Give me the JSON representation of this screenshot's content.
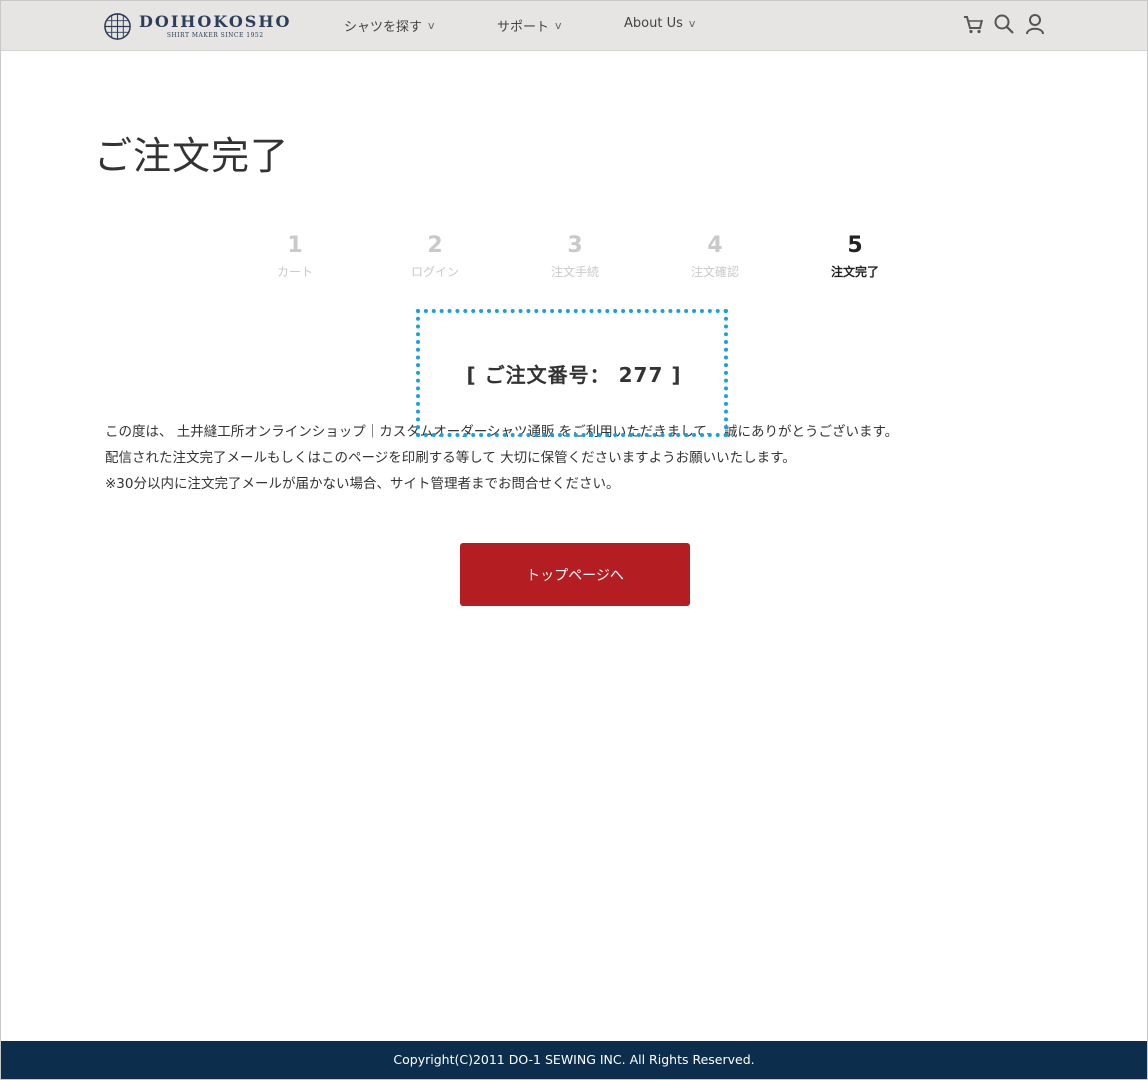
{
  "header": {
    "logo": {
      "name": "DOIHOKOSHO",
      "tagline": "SHIRT MAKER SINCE 1952"
    },
    "nav": [
      {
        "label": "シャツを探す",
        "chevron": "v"
      },
      {
        "label": "サポート",
        "chevron": "v"
      },
      {
        "label": "About Us",
        "chevron": "v"
      }
    ],
    "icons": [
      "cart-icon",
      "search-icon",
      "user-icon"
    ]
  },
  "page_title": "ご注文完了",
  "steps": [
    {
      "num": "1",
      "label": "カート",
      "active": false
    },
    {
      "num": "2",
      "label": "ログイン",
      "active": false
    },
    {
      "num": "3",
      "label": "注文手続",
      "active": false
    },
    {
      "num": "4",
      "label": "注文確認",
      "active": false
    },
    {
      "num": "5",
      "label": "注文完了",
      "active": true
    }
  ],
  "order": {
    "open": "[",
    "label": "ご注文番号：",
    "number": "277",
    "close": "]"
  },
  "message": {
    "line1": "この度は、 土井縫工所オンラインショップ｜カスタムオーダーシャツ通販 をご利用いただきまして、 誠にありがとうございます。",
    "line2": "配信された注文完了メールもしくはこのページを印刷する等して 大切に保管くださいますようお願いいたします。",
    "line3": "※30分以内に注文完了メールが届かない場合、サイト管理者までお問合せください。"
  },
  "button": {
    "label": "トップページへ"
  },
  "footer": {
    "copyright": "Copyright(C)2011 DO-1 SEWING INC. All Rights Reserved."
  },
  "colors": {
    "header_bg": "#e6e5e3",
    "brand_navy": "#2c3e58",
    "button_red": "#b41d22",
    "footer_bg": "#0d2d4d",
    "highlight": "#1aa2d6",
    "step_inactive": "#c9c9c9"
  }
}
